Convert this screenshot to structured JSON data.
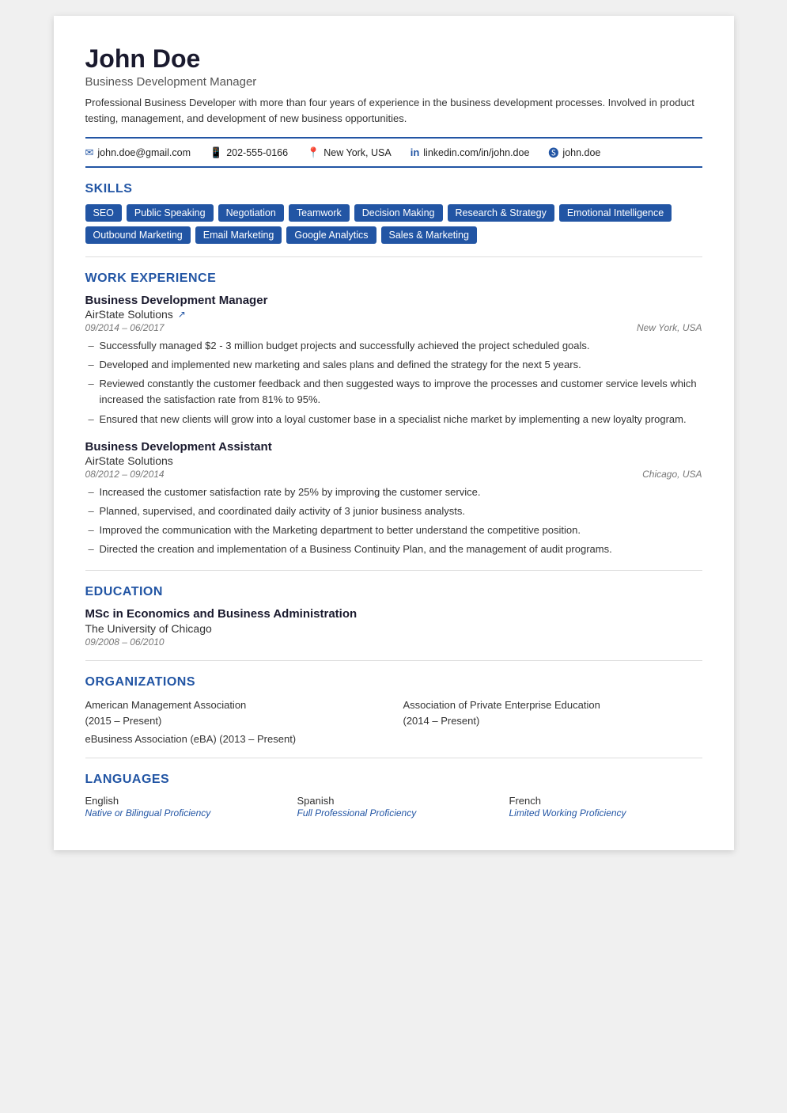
{
  "header": {
    "name": "John Doe",
    "title": "Business Development Manager",
    "summary": "Professional Business Developer with more than four years of experience in the business development processes. Involved in product testing, management, and development of new business opportunities."
  },
  "contact": {
    "email": "john.doe@gmail.com",
    "phone": "202-555-0166",
    "location": "New York, USA",
    "linkedin": "linkedin.com/in/john.doe",
    "skype": "john.doe"
  },
  "skills": {
    "section_title": "SKILLS",
    "tags": [
      "SEO",
      "Public Speaking",
      "Negotiation",
      "Teamwork",
      "Decision Making",
      "Research & Strategy",
      "Emotional Intelligence",
      "Outbound Marketing",
      "Email Marketing",
      "Google Analytics",
      "Sales & Marketing"
    ]
  },
  "work_experience": {
    "section_title": "WORK EXPERIENCE",
    "jobs": [
      {
        "title": "Business Development Manager",
        "company": "AirState Solutions",
        "has_link": true,
        "dates": "09/2014 – 06/2017",
        "location": "New York, USA",
        "bullets": [
          "Successfully managed $2 - 3 million budget projects and successfully achieved the project scheduled goals.",
          "Developed and implemented new marketing and sales plans and defined the strategy for the next 5 years.",
          "Reviewed constantly the customer feedback and then suggested ways to improve the processes and customer service levels which increased the satisfaction rate from 81% to 95%.",
          "Ensured that new clients will grow into a loyal customer base in a specialist niche market by implementing a new loyalty program."
        ]
      },
      {
        "title": "Business Development Assistant",
        "company": "AirState Solutions",
        "has_link": false,
        "dates": "08/2012 – 09/2014",
        "location": "Chicago, USA",
        "bullets": [
          "Increased the customer satisfaction rate by 25% by improving the customer service.",
          "Planned, supervised, and coordinated daily activity of 3 junior business analysts.",
          "Improved the communication with the Marketing department to better understand the competitive position.",
          "Directed the creation and implementation of a Business Continuity Plan, and the management of audit programs."
        ]
      }
    ]
  },
  "education": {
    "section_title": "EDUCATION",
    "entries": [
      {
        "degree": "MSc in Economics and Business Administration",
        "school": "The University of Chicago",
        "dates": "09/2008 – 06/2010"
      }
    ]
  },
  "organizations": {
    "section_title": "ORGANIZATIONS",
    "items": [
      {
        "name": "American Management Association",
        "years": "(2015 – Present)"
      },
      {
        "name": "Association of Private Enterprise Education",
        "years": "(2014 – Present)"
      }
    ],
    "extra": "eBusiness Association (eBA) (2013 – Present)"
  },
  "languages": {
    "section_title": "LANGUAGES",
    "entries": [
      {
        "language": "English",
        "level": "Native or Bilingual Proficiency"
      },
      {
        "language": "Spanish",
        "level": "Full Professional Proficiency"
      },
      {
        "language": "French",
        "level": "Limited Working Proficiency"
      }
    ]
  }
}
